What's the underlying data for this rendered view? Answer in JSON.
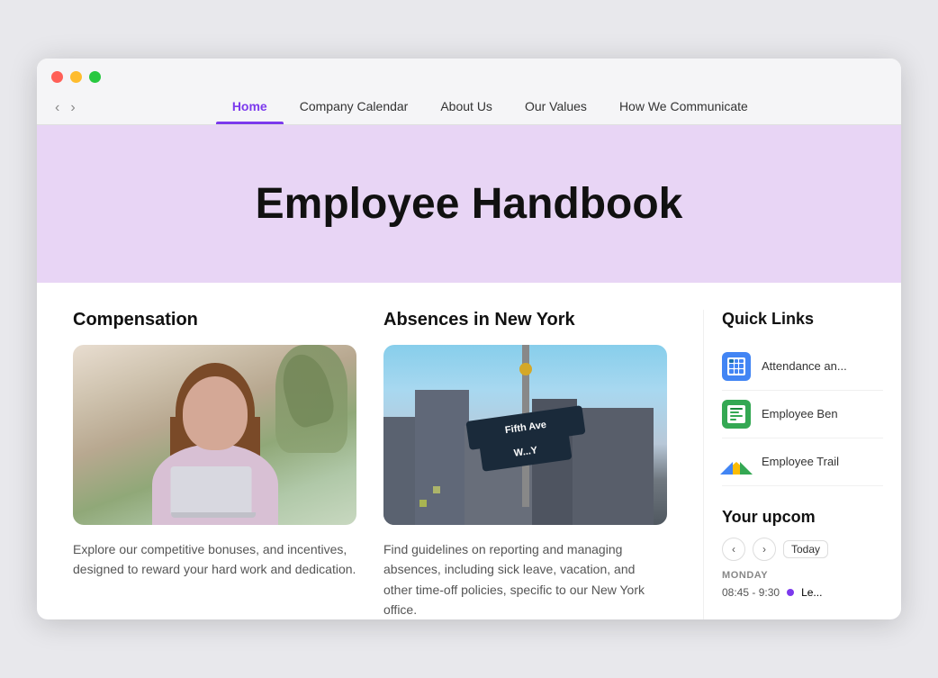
{
  "browser": {
    "traffic_lights": [
      "red",
      "yellow",
      "green"
    ],
    "nav_back": "‹",
    "nav_forward": "›"
  },
  "nav": {
    "tabs": [
      {
        "id": "home",
        "label": "Home",
        "active": true
      },
      {
        "id": "company-calendar",
        "label": "Company Calendar",
        "active": false
      },
      {
        "id": "about-us",
        "label": "About Us",
        "active": false
      },
      {
        "id": "our-values",
        "label": "Our Values",
        "active": false
      },
      {
        "id": "how-we-communicate",
        "label": "How We Communicate",
        "active": false
      }
    ]
  },
  "hero": {
    "title": "Employee Handbook"
  },
  "cards": [
    {
      "id": "compensation",
      "title": "Compensation",
      "description": "Explore our competitive bonuses, and incentives, designed to reward your hard work and dedication."
    },
    {
      "id": "absences",
      "title": "Absences in New York",
      "description": "Find guidelines on reporting and managing absences, including sick leave, vacation, and other time-off policies, specific to our New York office.",
      "sign_text": "Fifth Ave"
    }
  ],
  "sidebar": {
    "quick_links_title": "Quick Links",
    "links": [
      {
        "id": "attendance",
        "label": "Attendance an...",
        "icon_type": "sheets"
      },
      {
        "id": "employee-ben",
        "label": "Employee Ben",
        "icon_type": "forms"
      },
      {
        "id": "employee-trail",
        "label": "Employee Trail",
        "icon_type": "drive"
      }
    ],
    "upcoming_title": "Your upcom",
    "calendar": {
      "prev": "‹",
      "next": "›",
      "today": "Today"
    },
    "day_label": "MONDAY",
    "event": {
      "time": "08:45 - 9:30",
      "dot_color": "#7c3aed",
      "label": "Le..."
    }
  }
}
